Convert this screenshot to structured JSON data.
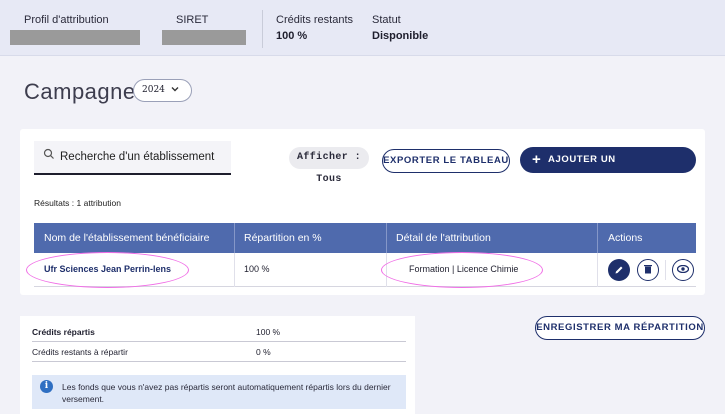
{
  "header": {
    "profile_label": "Profil d'attribution",
    "siret_label": "SIRET",
    "credits_label": "Crédits restants",
    "credits_value": "100 %",
    "status_label": "Statut",
    "status_value": "Disponible"
  },
  "campaign": {
    "title": "Campagne",
    "year": "2024"
  },
  "toolbar": {
    "search_placeholder": "Recherche d'un établissement",
    "filter_chip": "Afficher : Tous",
    "export_label": "EXPORTER LE TABLEAU",
    "add_label": "AJOUTER UN ÉTABLISSEMENT"
  },
  "results_text": "Résultats : 1 attribution",
  "table": {
    "columns": [
      "Nom de l'établissement bénéficiaire",
      "Répartition en %",
      "Détail de l'attribution",
      "Actions"
    ],
    "rows": [
      {
        "name": "Ufr Sciences Jean Perrin-lens",
        "percent": "100 %",
        "detail": "Formation | Licence Chimie"
      }
    ]
  },
  "summary": {
    "rows": [
      {
        "label": "Crédits répartis",
        "value": "100 %"
      },
      {
        "label": "Crédits restants à répartir",
        "value": "0 %"
      }
    ],
    "info": "Les fonds que vous n'avez pas répartis seront automatiquement répartis lors du dernier versement."
  },
  "save_label": "ENREGISTRER MA RÉPARTITION",
  "colors": {
    "primary": "#1e2f6b",
    "table_header": "#4f6aad",
    "highlight": "#f06ee6",
    "info_bg": "#dfe8f8"
  },
  "icons": [
    "search-icon",
    "chevron-down-icon",
    "plus-icon",
    "edit-icon",
    "delete-icon",
    "view-icon",
    "info-icon"
  ]
}
